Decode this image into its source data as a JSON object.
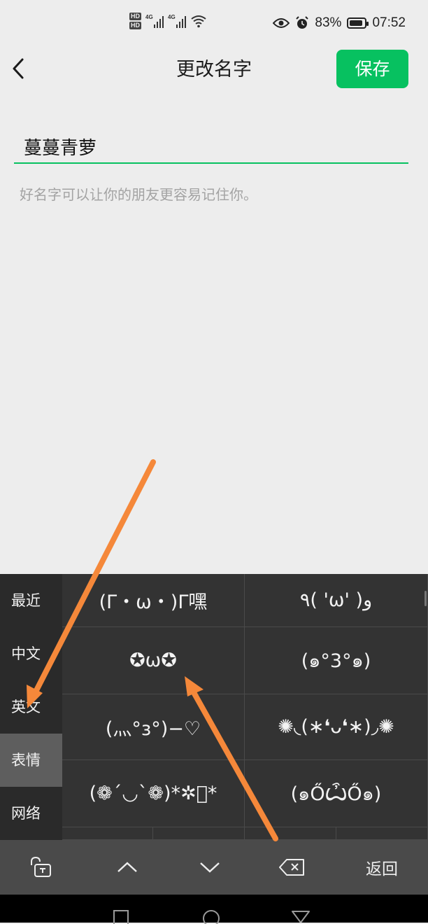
{
  "status_bar": {
    "hd1": "HD",
    "hd2": "HD",
    "net1": "4G",
    "net2": "4G",
    "battery": "83%",
    "time": "07:52"
  },
  "header": {
    "title": "更改名字",
    "save_label": "保存"
  },
  "name_field": {
    "value": "蔓蔓青萝"
  },
  "hint": "好名字可以让你的朋友更容易记住你。",
  "keyboard": {
    "categories": [
      "最近",
      "中文",
      "英文",
      "表情",
      "网络"
    ],
    "active_category": "表情",
    "emoticons": [
      "(Γ・ω・)Γ嘿",
      "٩( 'ω' )و",
      "✪ω✪",
      "(๑°3°๑)",
      "(灬°з°)−♡",
      "✺◟(∗❛ᴗ❛∗)◞✺",
      "(❁´◡`❁)*✲ﾟ*",
      "(๑ŐѼŐ๑)"
    ]
  },
  "toolbar": {
    "back_label": "返回"
  },
  "colors": {
    "accent": "#07c160",
    "arrow": "#f5883a",
    "keyboard_bg": "#333333"
  }
}
